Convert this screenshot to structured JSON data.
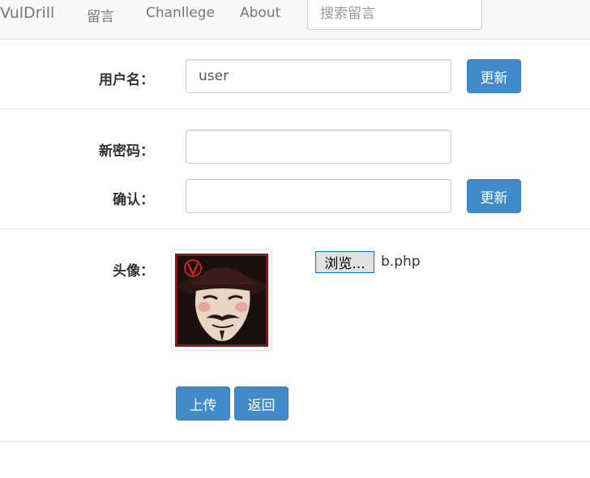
{
  "navbar": {
    "brand": "VulDrill",
    "links": [
      "留言",
      "Chanllege",
      "About"
    ],
    "search_placeholder": "搜索留言"
  },
  "username_section": {
    "label": "用户名：",
    "value": "user",
    "button": "更新"
  },
  "password_section": {
    "new_label": "新密码：",
    "new_value": "",
    "confirm_label": "确认：",
    "confirm_value": "",
    "button": "更新"
  },
  "avatar_section": {
    "label": "头像：",
    "avatar_image": "anonymous-mask-avatar",
    "browse_button": "浏览...",
    "selected_file": "b.php",
    "upload_button": "上传",
    "back_button": "返回"
  },
  "colors": {
    "primary_button": "#428bca",
    "navbar_bg": "#f8f8f8"
  }
}
